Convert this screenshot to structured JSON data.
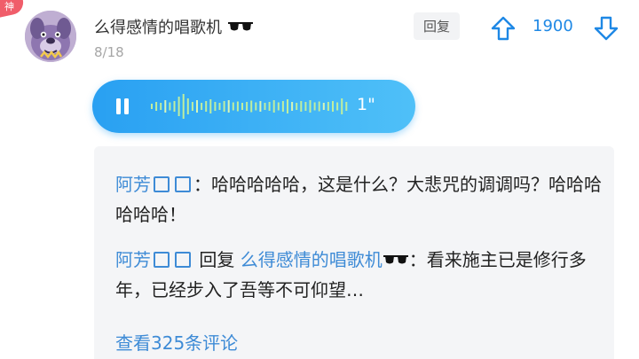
{
  "badge": {
    "label": "神"
  },
  "comment": {
    "username": "么得感情的唱歌机",
    "date": "8/18",
    "reply_label": "回复",
    "vote_count": "1900",
    "voice_duration": "1\""
  },
  "replies": [
    {
      "user": "阿芳",
      "separator": "：",
      "text": "哈哈哈哈哈，这是什么？大悲咒的调调吗？哈哈哈哈哈哈！"
    },
    {
      "user": "阿芳",
      "reply_word": "回复",
      "target": "么得感情的唱歌机",
      "separator": "：",
      "text": "看来施主已是修行多年，已经步入了吾等不可仰望…"
    }
  ],
  "view_more": "查看325条评论",
  "icons": {
    "avatar": "cartoon-dog-avatar",
    "upvote": "arrow-up-icon",
    "downvote": "arrow-down-icon",
    "pause": "pause-icon",
    "sunglasses": "sunglasses-emoji"
  },
  "colors": {
    "accent": "#1e88e5",
    "link": "#3e8bd6",
    "voice_bubble": "#29a0f2",
    "badge": "#f05d6a"
  }
}
